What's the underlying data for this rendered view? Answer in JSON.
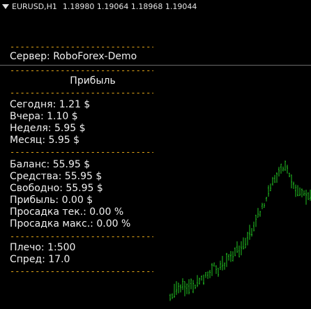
{
  "window": {
    "symbol_label": "EURUSD,H1",
    "ohlc": "1.18980 1.19064 1.18968 1.19044"
  },
  "panel": {
    "dashes": "----------------------------------------",
    "server_label": "Сервер: RoboForex-Demo",
    "profit_header": "Прибыль",
    "today": "Сегодня: 1.21 $",
    "yesterday": "Вчера: 1.10 $",
    "week": "Неделя: 5.95 $",
    "month": "Месяц: 5.95 $",
    "balance": "Баланс: 55.95 $",
    "equity": "Средства: 55.95 $",
    "free_margin": "Свободно: 55.95 $",
    "profit": "Прибыль: 0.00 $",
    "drawdown_current": "Просадка тек.: 0.00 %",
    "drawdown_max": "Просадка макс.: 0.00 %",
    "leverage": "Плечо: 1:500",
    "spread": "Спред: 17.0"
  },
  "colors": {
    "background": "#000000",
    "text": "#f0f0f0",
    "dashes": "#e6a817",
    "candles": "#22c322"
  },
  "chart_data": {
    "type": "bar",
    "symbol": "EURUSD",
    "timeframe": "H1",
    "open": 1.1898,
    "high": 1.19064,
    "low": 1.18968,
    "close": 1.19044
  }
}
